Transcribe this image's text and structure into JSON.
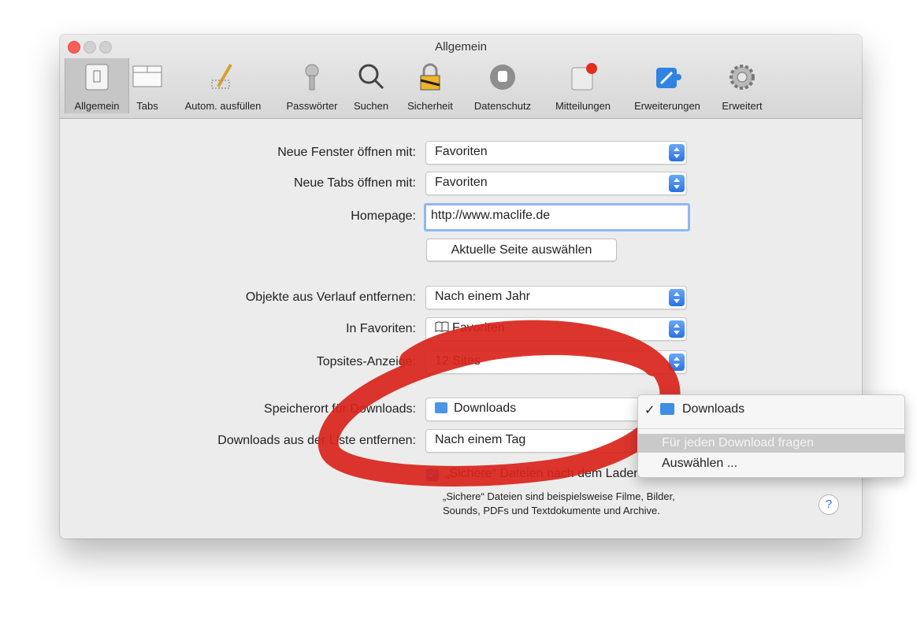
{
  "window": {
    "title": "Allgemein"
  },
  "toolbar": {
    "items": [
      {
        "label": "Allgemein",
        "icon": "switch-icon"
      },
      {
        "label": "Tabs",
        "icon": "tabs-icon"
      },
      {
        "label": "Autom. ausfüllen",
        "icon": "pencil-icon"
      },
      {
        "label": "Passwörter",
        "icon": "key-icon"
      },
      {
        "label": "Suchen",
        "icon": "magnifier-icon"
      },
      {
        "label": "Sicherheit",
        "icon": "lock-icon"
      },
      {
        "label": "Datenschutz",
        "icon": "hand-icon"
      },
      {
        "label": "Mitteilungen",
        "icon": "notification-icon"
      },
      {
        "label": "Erweiterungen",
        "icon": "puzzle-icon"
      },
      {
        "label": "Erweitert",
        "icon": "gear-icon"
      }
    ]
  },
  "form": {
    "new_window_label": "Neue Fenster öffnen mit:",
    "new_window_value": "Favoriten",
    "new_tabs_label": "Neue Tabs öffnen mit:",
    "new_tabs_value": "Favoriten",
    "homepage_label": "Homepage:",
    "homepage_value": "http://www.maclife.de",
    "current_page_button": "Aktuelle Seite auswählen",
    "history_label": "Objekte aus Verlauf entfernen:",
    "history_value": "Nach einem Jahr",
    "favorites_label": "In Favoriten:",
    "favorites_value": "Favoriten",
    "topsites_label": "Topsites-Anzeige:",
    "topsites_value": "12 Sites",
    "download_location_label": "Speicherort für Downloads:",
    "download_location_value": "Downloads",
    "remove_downloads_label": "Downloads aus der Liste entfernen:",
    "remove_downloads_value": "Nach einem Tag",
    "safe_files_label": "„Sichere“ Dateien nach dem Laden öffnen",
    "safe_files_help_line1": "„Sichere“ Dateien sind beispielsweise Filme, Bilder,",
    "safe_files_help_line2": "Sounds, PDFs und Textdokumente und Archive."
  },
  "menu": {
    "items": [
      "Downloads",
      "Für jeden Download fragen",
      "Auswählen ..."
    ]
  },
  "colors": {
    "annotation": "#d8241b",
    "accent": "#2a72e4"
  }
}
